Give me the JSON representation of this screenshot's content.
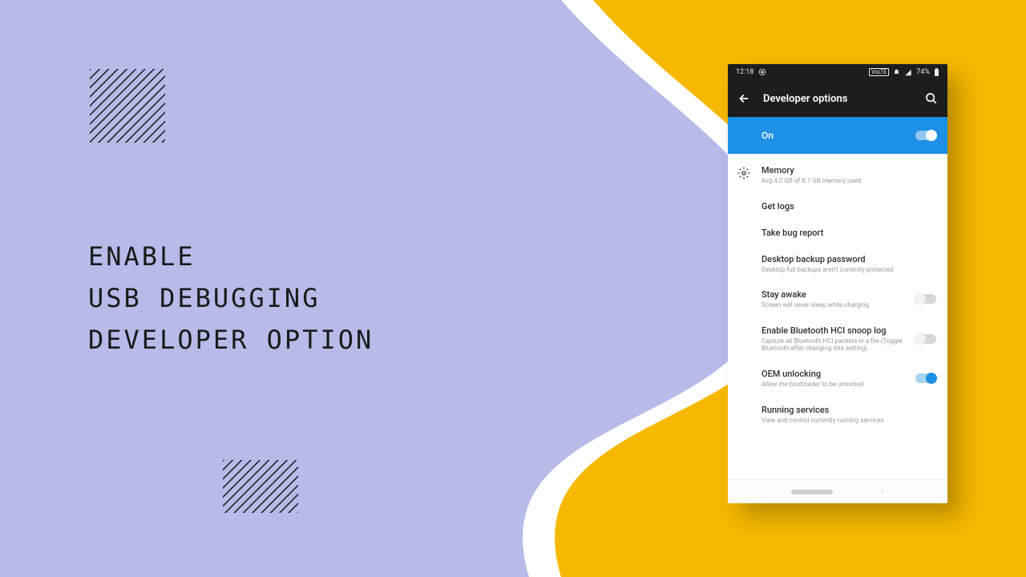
{
  "headline": {
    "line1": "ENABLE",
    "line2": "USB DEBUGGING",
    "line3": "DEVELOPER OPTION"
  },
  "status": {
    "time": "12:18",
    "battery": "74%",
    "label": "VoLTE"
  },
  "appbar": {
    "title": "Developer options"
  },
  "onbar": {
    "label": "On"
  },
  "items": [
    {
      "title": "Memory",
      "sub": "Avg 4.0 GB of 8.1 GB memory used",
      "icon": true
    },
    {
      "title": "Get logs",
      "sub": ""
    },
    {
      "title": "Take bug report",
      "sub": ""
    },
    {
      "title": "Desktop backup password",
      "sub": "Desktop full backups aren't currently protected"
    },
    {
      "title": "Stay awake",
      "sub": "Screen will never sleep while charging",
      "toggle": "off"
    },
    {
      "title": "Enable Bluetooth HCI snoop log",
      "sub": "Capture all Bluetooth HCI packets in a file (Toggle Bluetooth after changing this setting)",
      "toggle": "off"
    },
    {
      "title": "OEM unlocking",
      "sub": "Allow the bootloader to be unlocked",
      "toggle": "on"
    },
    {
      "title": "Running services",
      "sub": "View and control currently running services"
    }
  ]
}
